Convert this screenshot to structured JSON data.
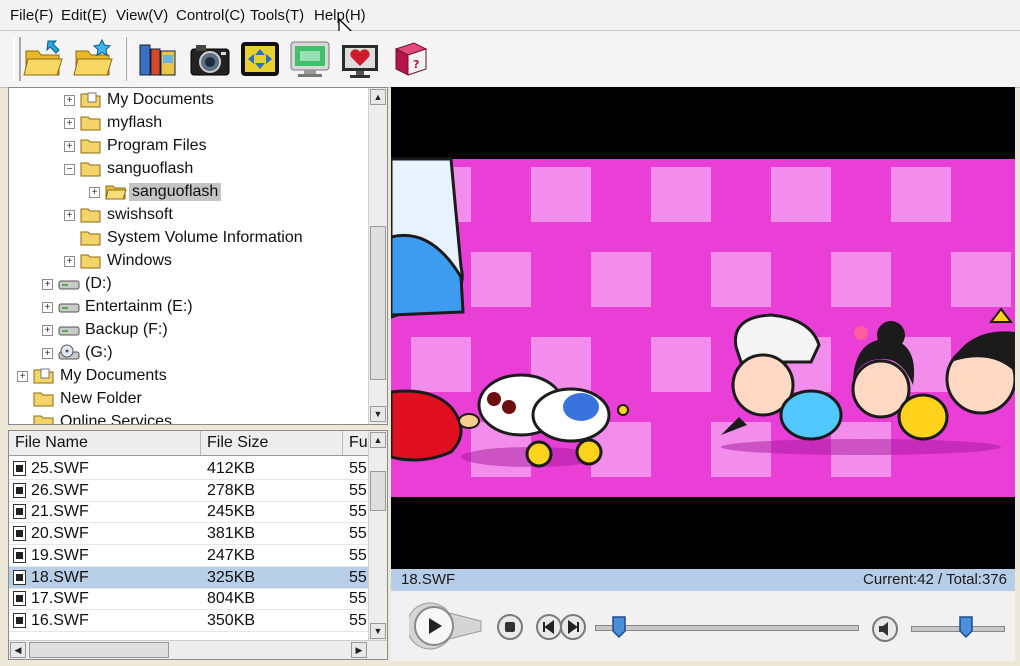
{
  "menu": [
    "File(F)",
    "Edit(E)",
    "View(V)",
    "Control(C)",
    "Tools(T)",
    "Help(H)"
  ],
  "toolbar": {
    "buttons": [
      {
        "name": "open-folder-icon"
      },
      {
        "name": "favorite-folder-icon"
      },
      {
        "name": "library-icon"
      },
      {
        "name": "camera-icon"
      },
      {
        "name": "fullscreen-icon"
      },
      {
        "name": "monitor-icon"
      },
      {
        "name": "heart-screen-icon"
      },
      {
        "name": "help-book-icon"
      }
    ]
  },
  "tree": {
    "items": [
      {
        "label": "My Documents",
        "expander": "+",
        "icon": "folder-docs"
      },
      {
        "label": "myflash",
        "expander": "+",
        "icon": "folder"
      },
      {
        "label": "Program Files",
        "expander": "+",
        "icon": "folder"
      },
      {
        "label": "sanguoflash",
        "expander": "−",
        "icon": "folder"
      },
      {
        "label": "sanguoflash",
        "expander": "+",
        "icon": "folder-open",
        "selected": true
      },
      {
        "label": "swishsoft",
        "expander": "+",
        "icon": "folder"
      },
      {
        "label": "System Volume Information",
        "expander": "",
        "icon": "folder"
      },
      {
        "label": "Windows",
        "expander": "+",
        "icon": "folder"
      },
      {
        "label": "(D:)",
        "expander": "+",
        "icon": "drive"
      },
      {
        "label": "Entertainm (E:)",
        "expander": "+",
        "icon": "drive"
      },
      {
        "label": "Backup (F:)",
        "expander": "+",
        "icon": "drive"
      },
      {
        "label": "(G:)",
        "expander": "+",
        "icon": "cd-drive"
      },
      {
        "label": "My Documents",
        "expander": "+",
        "icon": "folder-docs"
      },
      {
        "label": "New Folder",
        "expander": "",
        "icon": "folder"
      },
      {
        "label": "Online Services",
        "expander": "",
        "icon": "folder"
      }
    ]
  },
  "file_list": {
    "columns": [
      "File Name",
      "File Size",
      "Fu"
    ],
    "rows": [
      {
        "name": "25.SWF",
        "size": "412KB",
        "extra": "55"
      },
      {
        "name": "26.SWF",
        "size": "278KB",
        "extra": "55"
      },
      {
        "name": "21.SWF",
        "size": "245KB",
        "extra": "55"
      },
      {
        "name": "20.SWF",
        "size": "381KB",
        "extra": "55"
      },
      {
        "name": "19.SWF",
        "size": "247KB",
        "extra": "55"
      },
      {
        "name": "18.SWF",
        "size": "325KB",
        "extra": "55",
        "selected": true
      },
      {
        "name": "17.SWF",
        "size": "804KB",
        "extra": "55"
      },
      {
        "name": "16.SWF",
        "size": "350KB",
        "extra": "55"
      }
    ]
  },
  "player": {
    "filename": "18.SWF",
    "frame_info": "Current:42 / Total:376",
    "progress": 0.09,
    "volume": 0.6
  },
  "colors": {
    "status_bg": "#b5cde6",
    "selection": "#b9cfe8",
    "video_pink": "#e93fd6"
  }
}
